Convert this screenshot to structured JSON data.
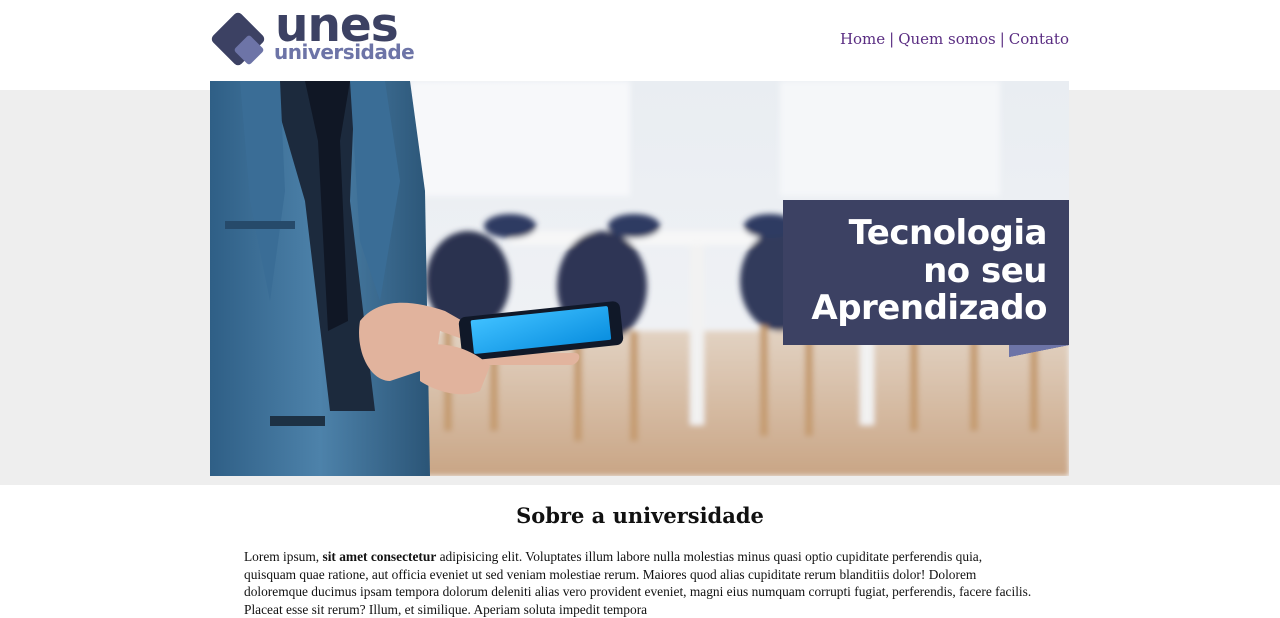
{
  "header": {
    "logo": {
      "primary": "unes",
      "secondary": "universidade"
    },
    "nav": [
      {
        "label": "Home"
      },
      {
        "label": "Quem somos"
      },
      {
        "label": "Contato"
      }
    ],
    "nav_separator": "|"
  },
  "banner": {
    "caption_lines": [
      "Tecnologia",
      "no seu",
      "Aprendizado"
    ],
    "image_description_icon": "banner-photo"
  },
  "about": {
    "title": "Sobre a universidade",
    "text_before_bold": "Lorem ipsum, ",
    "text_bold": "sit amet consectetur",
    "text_after_bold": " adipisicing elit. Voluptates illum labore nulla molestias minus quasi optio cupiditate perferendis quia, quisquam quae ratione, aut officia eveniet ut sed veniam molestiae rerum. Maiores quod alias cupiditate rerum blanditiis dolor! Dolorem doloremque ducimus ipsam tempora dolorum deleniti alias vero provident eveniet, magni eius numquam corrupti fugiat, perferendis, facere facilis. Placeat esse sit rerum? Illum, et similique. Aperiam soluta impedit tempora"
  },
  "colors": {
    "brand_dark": "#3c4163",
    "brand_light": "#6d74a7",
    "nav_link": "#5a2d82",
    "band": "#eeeeee"
  }
}
